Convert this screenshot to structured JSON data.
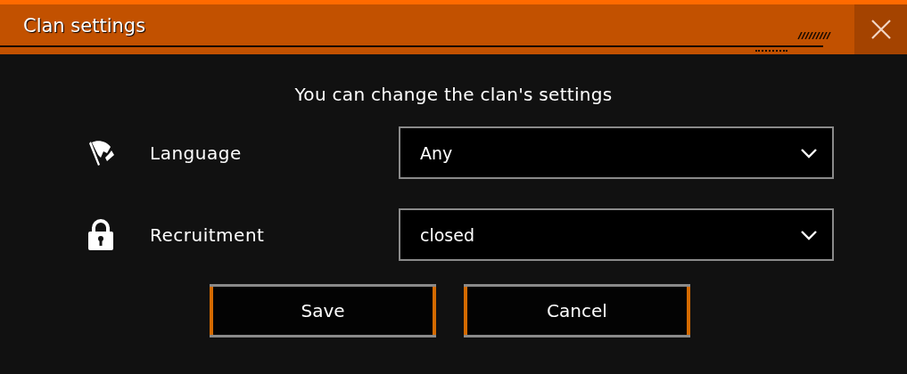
{
  "window": {
    "title": "Clan settings"
  },
  "message": "You can change the clan's settings",
  "settings": [
    {
      "kind": "language",
      "label": "Language",
      "value": "Any"
    },
    {
      "kind": "recruitment",
      "label": "Recruitment",
      "value": "closed"
    }
  ],
  "buttons": [
    "Save",
    "Cancel"
  ]
}
